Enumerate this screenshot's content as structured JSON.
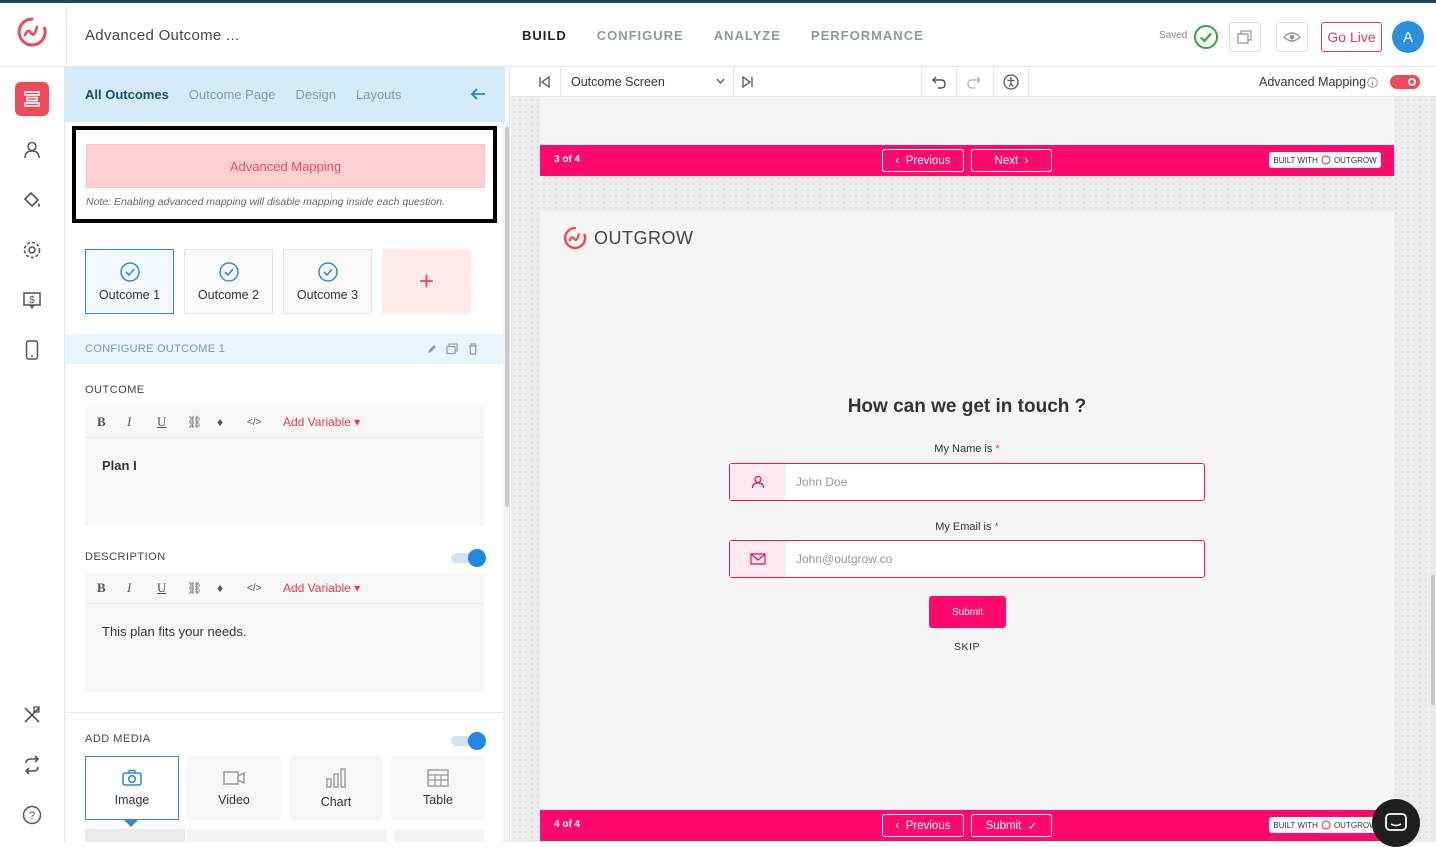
{
  "header": {
    "app_title": "Advanced Outcome ...",
    "nav": [
      "BUILD",
      "CONFIGURE",
      "ANALYZE",
      "PERFORMANCE"
    ],
    "active_nav": "BUILD",
    "saved_label": "Saved",
    "go_live_label": "Go Live",
    "avatar_initial": "A"
  },
  "colors": {
    "brand": "#ef4a57",
    "accent_blue": "#2b8fd2",
    "preview_pink": "#ff0a6c"
  },
  "rail": {
    "icons": [
      "build-icon",
      "user-icon",
      "paint-bucket-icon",
      "gear-icon",
      "dollar-chat-icon",
      "mobile-icon",
      "tools-icon",
      "refresh-icon",
      "help-icon"
    ]
  },
  "panel": {
    "tabs": [
      "All Outcomes",
      "Outcome Page",
      "Design",
      "Layouts"
    ],
    "active_tab": "All Outcomes",
    "advanced_mapping_button": "Advanced Mapping",
    "advanced_mapping_note": "Note: Enabling advanced mapping will disable mapping inside each question.",
    "outcomes": [
      "Outcome 1",
      "Outcome 2",
      "Outcome 3"
    ],
    "add_symbol": "+",
    "configure_label": "CONFIGURE OUTCOME 1",
    "outcome_section": {
      "label": "OUTCOME",
      "add_variable": "Add Variable",
      "content": "Plan I"
    },
    "description_section": {
      "label": "DESCRIPTION",
      "add_variable": "Add Variable",
      "content": "This plan fits your needs.",
      "toggle_on": true
    },
    "media_section": {
      "label": "ADD MEDIA",
      "toggle_on": true,
      "options": [
        "Image",
        "Video",
        "Chart",
        "Table"
      ],
      "selected": "Image"
    }
  },
  "preview_toolbar": {
    "screen_select": "Outcome Screen",
    "advanced_mapping_label": "Advanced Mapping",
    "advanced_mapping_on": true
  },
  "preview": {
    "prev_screen": {
      "count": "3 of 4",
      "previous": "Previous",
      "next": "Next",
      "built_with": "BUILT WITH",
      "built_brand": "OUTGROW"
    },
    "screen": {
      "brand": "OUTGROW",
      "title": "How can we get in touch ?",
      "name_label": "My Name is",
      "name_placeholder": "John Doe",
      "email_label": "My Email is",
      "email_placeholder": "John@outgrow.co",
      "required_mark": "*",
      "submit": "Submit",
      "skip": "SKIP"
    },
    "bottom_bar": {
      "count": "4 of 4",
      "previous": "Previous",
      "submit": "Submit",
      "built_with": "BUILT WITH",
      "built_brand": "OUTGROW"
    }
  }
}
